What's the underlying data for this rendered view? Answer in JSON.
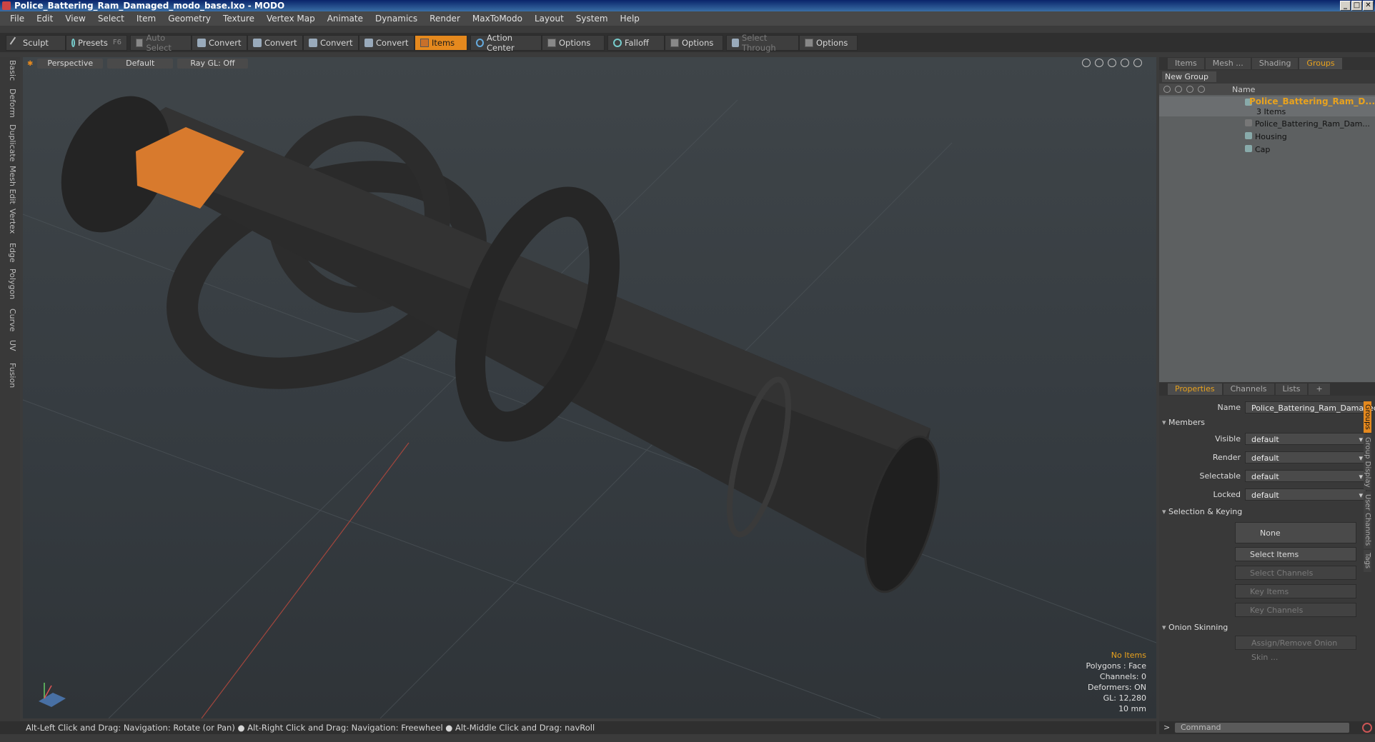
{
  "window": {
    "title": "Police_Battering_Ram_Damaged_modo_base.lxo - MODO",
    "controls": [
      "_",
      "□",
      "✕"
    ]
  },
  "menu": [
    "File",
    "Edit",
    "View",
    "Select",
    "Item",
    "Geometry",
    "Texture",
    "Vertex Map",
    "Animate",
    "Dynamics",
    "Render",
    "MaxToModo",
    "Layout",
    "System",
    "Help"
  ],
  "toolbar": {
    "sculpt": "Sculpt",
    "presets": "Presets",
    "presets_key": "F6",
    "auto_select": "Auto Select",
    "convert1": "Convert",
    "convert2": "Convert",
    "convert3": "Convert",
    "convert4": "Convert",
    "items": "Items",
    "action_center": "Action Center",
    "options1": "Options",
    "falloff": "Falloff",
    "options2": "Options",
    "select_through": "Select Through",
    "options3": "Options"
  },
  "left_tabs": [
    "Basic",
    "Deform",
    "Duplicate",
    "Mesh Edit",
    "Vertex",
    "Edge",
    "Polygon",
    "Curve",
    "UV",
    "Fusion"
  ],
  "viewport": {
    "projection": "Perspective",
    "shading": "Default",
    "raygl": "Ray GL: Off",
    "stats": {
      "items": "No Items",
      "polygons": "Polygons : Face",
      "channels": "Channels: 0",
      "deformers": "Deformers: ON",
      "gl": "GL: 12,280",
      "scale": "10 mm"
    }
  },
  "statusbar": "Alt-Left Click and Drag: Navigation: Rotate (or Pan) ● Alt-Right Click and Drag: Navigation: Freewheel ● Alt-Middle Click and Drag: navRoll",
  "top_panel": {
    "tabs": [
      "Items",
      "Mesh ...",
      "Shading",
      "Groups"
    ],
    "active_tab": "Groups",
    "new_group": "New Group",
    "name_header": "Name",
    "root": {
      "label": "Police_Battering_Ram_D...",
      "count": "3 Items"
    },
    "children": [
      "Police_Battering_Ram_Dam...",
      "Housing",
      "Cap"
    ]
  },
  "properties": {
    "tabs": [
      "Properties",
      "Channels",
      "Lists",
      "+"
    ],
    "active_tab": "Properties",
    "name_label": "Name",
    "name_value": "Police_Battering_Ram_Damaged",
    "members_section": "Members",
    "visible_label": "Visible",
    "visible_value": "default",
    "render_label": "Render",
    "render_value": "default",
    "selectable_label": "Selectable",
    "selectable_value": "default",
    "locked_label": "Locked",
    "locked_value": "default",
    "selection_section": "Selection & Keying",
    "none_btn": "None",
    "select_items": "Select Items",
    "select_channels": "Select Channels",
    "key_items": "Key Items",
    "key_channels": "Key Channels",
    "onion_section": "Onion Skinning",
    "onion_btn": "Assign/Remove Onion Skin ..."
  },
  "side_tabs": [
    "Groups",
    "Group Display",
    "User Channels",
    "Tags"
  ],
  "command": {
    "arrow": ">",
    "placeholder": "Command"
  },
  "colors": {
    "accent": "#e5891e",
    "root_label": "#e8a21e"
  }
}
